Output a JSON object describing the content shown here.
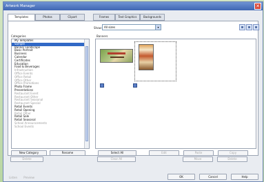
{
  "window": {
    "title": "Artwork Manager",
    "close_glyph": "✕"
  },
  "tabs": [
    "Templates",
    "Photos",
    "Clipart",
    "Frames",
    "Text Graphics",
    "Backgrounds"
  ],
  "filter": {
    "label": "Show:",
    "value": "All sizes",
    "arrow": "▾"
  },
  "categories": {
    "label": "Categories",
    "items": [
      {
        "text": "My Templates",
        "state": "normal"
      },
      {
        "text": "Sample",
        "state": "selected"
      },
      {
        "text": "Banner Landscape",
        "state": "normal"
      },
      {
        "text": "Basic Portrait",
        "state": "normal"
      },
      {
        "text": "Business",
        "state": "normal"
      },
      {
        "text": "Calendar",
        "state": "normal"
      },
      {
        "text": "Certificates",
        "state": "normal"
      },
      {
        "text": "Education",
        "state": "normal"
      },
      {
        "text": "Food & Beverages",
        "state": "normal"
      },
      {
        "text": "Infrastruction",
        "state": "dim"
      },
      {
        "text": "Office Events",
        "state": "dim"
      },
      {
        "text": "Office Retail",
        "state": "dim"
      },
      {
        "text": "Office Other",
        "state": "dim"
      },
      {
        "text": "Office Promotions",
        "state": "dim"
      },
      {
        "text": "Photo Frame",
        "state": "normal"
      },
      {
        "text": "Presentations",
        "state": "normal"
      },
      {
        "text": "Restaurant Event",
        "state": "dim"
      },
      {
        "text": "Restaurant Other",
        "state": "dim"
      },
      {
        "text": "Restaurant Seasonal",
        "state": "dim"
      },
      {
        "text": "Restaurant Special",
        "state": "dim"
      },
      {
        "text": "Retail Events",
        "state": "normal"
      },
      {
        "text": "Retail Opening",
        "state": "normal"
      },
      {
        "text": "Retail Other",
        "state": "dim"
      },
      {
        "text": "Retail Sale",
        "state": "normal"
      },
      {
        "text": "Retail Seasonal",
        "state": "normal"
      },
      {
        "text": "School Announcements",
        "state": "dim"
      },
      {
        "text": "School Events",
        "state": "dim"
      }
    ]
  },
  "thumbs_label": "Banners",
  "panel_buttons": {
    "new_category": "New Category",
    "rename": "Rename",
    "select_all": "Select All",
    "delete": "Delete",
    "clear_all": "Clear All",
    "edit": "Edit",
    "paste": "Paste",
    "copy": "Copy",
    "move": "Move",
    "delete2": "Delete"
  },
  "window_buttons": {
    "ok": "OK",
    "cancel": "Cancel",
    "help": "Help"
  },
  "footer": {
    "left1": "Listen",
    "left2": "Preview"
  }
}
